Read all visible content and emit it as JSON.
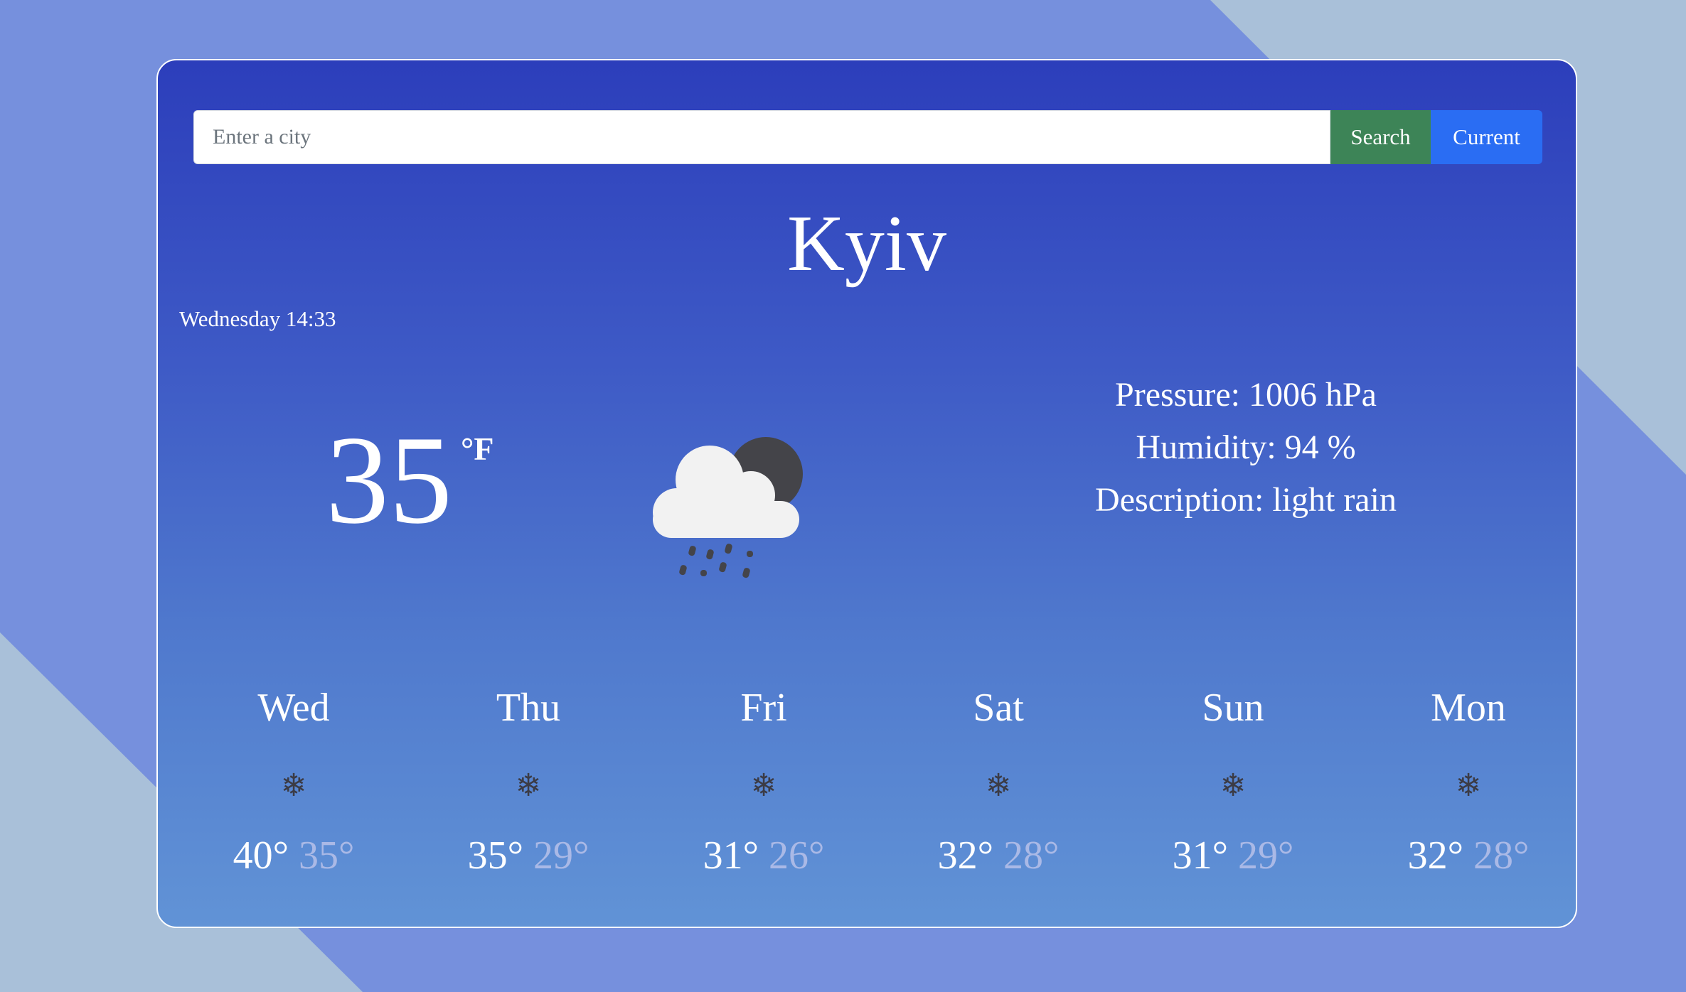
{
  "search": {
    "placeholder": "Enter a city",
    "value": "",
    "search_label": "Search",
    "current_label": "Current"
  },
  "city": "Kyiv",
  "datetime": "Wednesday 14:33",
  "current": {
    "temperature": "35",
    "unit": "°F",
    "icon": "cloud-rain-moon-icon"
  },
  "details": {
    "pressure": "Pressure: 1006 hPa",
    "humidity": "Humidity: 94 %",
    "description": "Description: light rain"
  },
  "forecast": [
    {
      "day": "Wed",
      "icon": "snowflake-icon",
      "max": "40°",
      "min": "35°"
    },
    {
      "day": "Thu",
      "icon": "snowflake-icon",
      "max": "35°",
      "min": "29°"
    },
    {
      "day": "Fri",
      "icon": "snowflake-icon",
      "max": "31°",
      "min": "26°"
    },
    {
      "day": "Sat",
      "icon": "snowflake-icon",
      "max": "32°",
      "min": "28°"
    },
    {
      "day": "Sun",
      "icon": "snowflake-icon",
      "max": "31°",
      "min": "29°"
    },
    {
      "day": "Mon",
      "icon": "snowflake-icon",
      "max": "32°",
      "min": "28°"
    }
  ],
  "colors": {
    "search_button": "#3d8457",
    "current_button": "#2a6df3",
    "min_temp": "#aab9e6",
    "forecast_icon": "#3b3b45"
  }
}
